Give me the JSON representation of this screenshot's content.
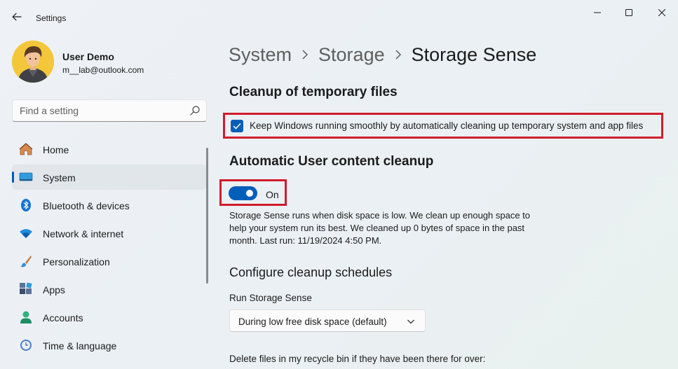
{
  "window": {
    "title": "Settings"
  },
  "profile": {
    "name": "User Demo",
    "email": "m__lab@outlook.com"
  },
  "search": {
    "placeholder": "Find a setting"
  },
  "sidebar": {
    "items": [
      {
        "label": "Home",
        "icon": "home-icon"
      },
      {
        "label": "System",
        "icon": "system-icon",
        "selected": true
      },
      {
        "label": "Bluetooth & devices",
        "icon": "bluetooth-icon"
      },
      {
        "label": "Network & internet",
        "icon": "wifi-icon"
      },
      {
        "label": "Personalization",
        "icon": "brush-icon"
      },
      {
        "label": "Apps",
        "icon": "apps-icon"
      },
      {
        "label": "Accounts",
        "icon": "account-icon"
      },
      {
        "label": "Time & language",
        "icon": "clock-globe-icon"
      }
    ]
  },
  "breadcrumb": {
    "items": [
      "System",
      "Storage",
      "Storage Sense"
    ]
  },
  "cleanup": {
    "title": "Cleanup of temporary files",
    "checkbox_label": "Keep Windows running smoothly by automatically cleaning up temporary system and app files",
    "checked": true
  },
  "auto_cleanup": {
    "title": "Automatic User content cleanup",
    "toggle_label": "On",
    "toggle_on": true,
    "description": "Storage Sense runs when disk space is low. We clean up enough space to help your system run its best. We cleaned up 0 bytes of space in the past month. Last run: 11/19/2024 4:50 PM."
  },
  "schedules": {
    "title": "Configure cleanup schedules",
    "run_label": "Run Storage Sense",
    "run_value": "During low free disk space (default)",
    "recycle_label": "Delete files in my recycle bin if they have been there for over:"
  },
  "colors": {
    "accent": "#005fb8",
    "highlight": "#d01c2b"
  }
}
